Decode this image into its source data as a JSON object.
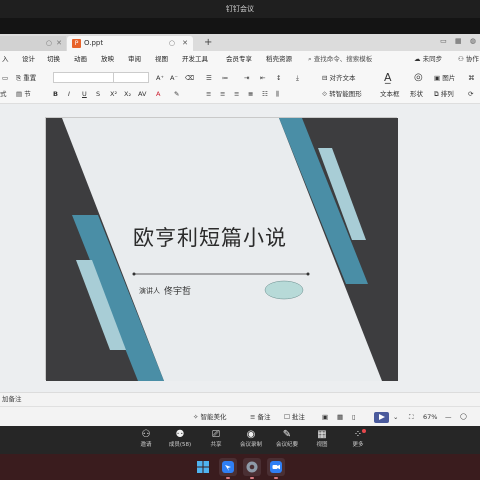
{
  "meeting": {
    "title": "钉钉会议",
    "controls": [
      {
        "label": "邀请",
        "icon": "invite-icon",
        "glyph": "⚇"
      },
      {
        "label": "成员(58)",
        "icon": "members-icon",
        "glyph": "⚉"
      },
      {
        "label": "共享",
        "icon": "share-screen-icon",
        "glyph": "⎚"
      },
      {
        "label": "会议录制",
        "icon": "record-icon",
        "glyph": "◉"
      },
      {
        "label": "会议纪要",
        "icon": "minutes-icon",
        "glyph": "✎"
      },
      {
        "label": "视图",
        "icon": "view-grid-icon",
        "glyph": "▦"
      },
      {
        "label": "更多",
        "icon": "more-icon",
        "glyph": "⁘"
      }
    ]
  },
  "wps": {
    "tabs": {
      "active_label": "O.ppt",
      "add": "+"
    },
    "menu": {
      "items": [
        "入",
        "设计",
        "切换",
        "动画",
        "放映",
        "审阅",
        "视图",
        "开发工具",
        "会员专享",
        "稻壳资源"
      ],
      "search": "查找命令、搜索模板",
      "sync": "未同步",
      "collab": "协作"
    },
    "toolbar": {
      "reset": "重置",
      "style": "式",
      "section": "节",
      "convert_smart": "转智能图形",
      "align_text": "对齐文本",
      "text_box": "文本框",
      "shape": "形状",
      "picture": "图片",
      "arrange": "排列"
    },
    "slide": {
      "title": "欧亨利短篇小说",
      "presenter_label": "演讲人",
      "presenter_name": "佟宇哲"
    },
    "notes_placeholder": "加备注",
    "status": {
      "beautify": "智能美化",
      "notes": "备注",
      "comments": "批注",
      "zoom": "67%"
    }
  },
  "colors": {
    "dark_band": "#3d3d3f",
    "teal_band": "#4a8ea6",
    "light_teal_band": "#a8cdd6",
    "slide_bg": "#e9ecee",
    "ellipse": "#b7dad8",
    "taskbar": "#3a1c1e"
  }
}
